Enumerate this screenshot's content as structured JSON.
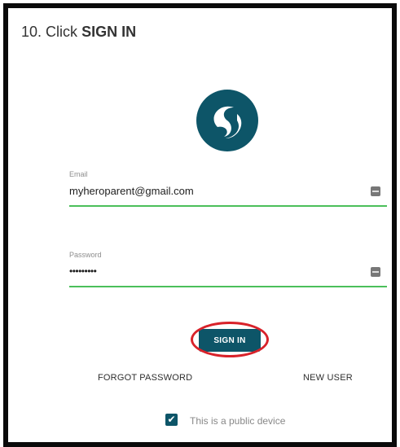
{
  "instruction": {
    "step_number": "10.",
    "verb": "Click",
    "target": "SIGN IN"
  },
  "logo": {
    "icon": "app-logo-icon",
    "color": "#0d5568"
  },
  "form": {
    "email": {
      "label": "Email",
      "value": "myheroparent@gmail.com",
      "icon": "password-manager-key-icon"
    },
    "password": {
      "label": "Password",
      "value": "•••••••••",
      "icon": "password-manager-key-icon"
    },
    "field_underline_color": "#4bbf5a"
  },
  "actions": {
    "sign_in_label": "SIGN IN",
    "forgot_password_label": "FORGOT PASSWORD",
    "new_user_label": "NEW USER",
    "highlight_color": "#d8222a",
    "button_color": "#0d5568"
  },
  "public_device": {
    "label": "This is a public device",
    "checked": true
  }
}
